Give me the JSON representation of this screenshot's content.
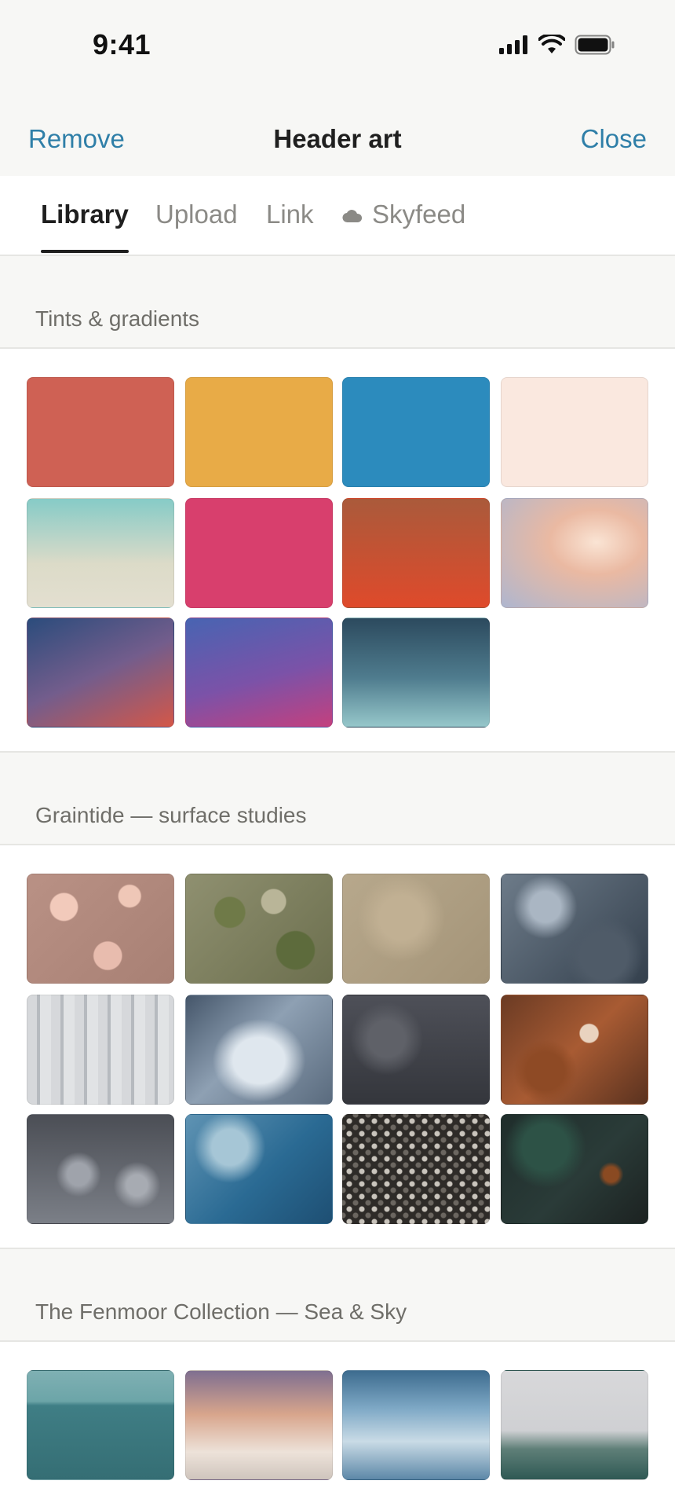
{
  "status": {
    "time": "9:41"
  },
  "nav": {
    "left": "Remove",
    "title": "Header art",
    "right": "Close"
  },
  "tabs": [
    {
      "label": "Library",
      "active": true
    },
    {
      "label": "Upload",
      "active": false
    },
    {
      "label": "Link",
      "active": false
    },
    {
      "label": "Skyfeed",
      "active": false,
      "icon": "cloud-icon"
    }
  ],
  "sections": [
    {
      "title": "Tints & gradients",
      "items": [
        {
          "name": "solid-red",
          "css": "#cf6154"
        },
        {
          "name": "solid-yellow",
          "css": "#e8ab47"
        },
        {
          "name": "solid-blue",
          "css": "#2c8bbd"
        },
        {
          "name": "solid-cream",
          "css": "#fae8df"
        },
        {
          "name": "gradient-teal-sand",
          "css": "linear-gradient(180deg,#86cbc7 0%,#dcdbc8 60%,#e3dfd0 100%)"
        },
        {
          "name": "solid-pink",
          "css": "#d83f6d"
        },
        {
          "name": "gradient-rust-orange",
          "css": "linear-gradient(180deg,#aa5a3b 0%,#df4a2b 100%)"
        },
        {
          "name": "gradient-peach-glow",
          "css": "radial-gradient(ellipse at 65% 40%,#fae4d4 0%,#eab9a2 35%,#aeb6cf 100%)"
        },
        {
          "name": "gradient-navy-coral",
          "css": "linear-gradient(155deg,#2b4c7c 0%,#735d8c 50%,#d45748 100%)"
        },
        {
          "name": "gradient-indigo-magenta",
          "css": "linear-gradient(165deg,#4864b2 0%,#7b52a8 55%,#c4407e 100%)"
        },
        {
          "name": "gradient-slate-seafoam",
          "css": "linear-gradient(180deg,#2c4a5e 0%,#4f7c8e 55%,#96c7ca 100%)"
        }
      ]
    },
    {
      "title": "Graintide — surface studies",
      "items": [
        {
          "name": "texture-rose-plaster",
          "css": "radial-gradient(circle at 25% 30%,#f2cabb 0 10%,transparent 11%),radial-gradient(circle at 70% 20%,#efc7b7 0 8%,transparent 9%),radial-gradient(circle at 55% 75%,#e8bcae 0 12%,transparent 13%),linear-gradient(135deg,#b99185,#a88074)"
        },
        {
          "name": "texture-moss-peel",
          "css": "radial-gradient(circle at 30% 35%,#6f7a48 0 12%,transparent 13%),radial-gradient(circle at 75% 70%,#5d6b3c 0 14%,transparent 15%),radial-gradient(circle at 60% 25%,#b9b598 0 10%,transparent 11%),linear-gradient(135deg,#8f9070,#6c6f4e)"
        },
        {
          "name": "texture-sand-stone",
          "css": "radial-gradient(circle at 40% 40%,#c1b093 0 20%,transparent 40%),linear-gradient(135deg,#b7a88c,#a49478)"
        },
        {
          "name": "texture-blue-grunge",
          "css": "radial-gradient(circle at 30% 30%,#aab6c3 0 12%,transparent 25%),radial-gradient(circle at 70% 75%,#4f5b68 0 18%,transparent 30%),linear-gradient(135deg,#6d7b89,#34404d)"
        },
        {
          "name": "texture-white-drip",
          "css": "repeating-linear-gradient(90deg,#d6d8db 0 12px,#b6babf 12px 16px,#e1e3e5 16px 30px),linear-gradient(180deg,#d0d2d5,#c2c5c9)"
        },
        {
          "name": "texture-frost-glass",
          "css": "radial-gradient(ellipse at 50% 60%,#dfe7ee 0 25%,transparent 45%),linear-gradient(135deg,#45566a,#8ea0b3 45%,#5a6b7e)"
        },
        {
          "name": "texture-charcoal-wall",
          "css": "radial-gradient(circle at 30% 40%,#5f6168 0 15%,transparent 30%),linear-gradient(180deg,#4e5058,#34363c)"
        },
        {
          "name": "texture-rust-patina",
          "css": "radial-gradient(circle at 60% 35%,#e9d3bf 0 8%,transparent 9%),radial-gradient(circle at 30% 70%,#8e4a25 0 15%,transparent 25%),linear-gradient(135deg,#6b3b24,#a85b33 50%,#5a321f)"
        },
        {
          "name": "texture-pewter-swirl",
          "css": "radial-gradient(circle at 35% 55%,#9fa3ab 0 10%,transparent 20%),radial-gradient(circle at 75% 65%,#a7abb2 0 8%,transparent 18%),linear-gradient(180deg,#4b4e55,#7b7f87)"
        },
        {
          "name": "texture-blue-droplets",
          "css": "radial-gradient(circle at 30% 30%,#a6c6d6 0 14%,transparent 28%),linear-gradient(135deg,#5f93b3,#2a6a93 55%,#1e4f73)"
        },
        {
          "name": "texture-pebble-gravel",
          "css": "radial-gradient(circle,#c9c4bc 0 3px,transparent 4px) 0 0/16px 16px,radial-gradient(circle,#6b6660 0 3px,transparent 4px) 8px 8px/16px 16px,#2e2b28"
        },
        {
          "name": "texture-verdigris-rust",
          "css": "radial-gradient(circle at 30% 30%,#2d5246 0 18%,transparent 32%),radial-gradient(circle at 75% 55%,#8a4a22 0 6%,transparent 10%),linear-gradient(135deg,#1f2d2b,#2a3b38 55%,#1c2221)"
        }
      ]
    },
    {
      "title": "The Fenmoor Collection — Sea & Sky",
      "items": [
        {
          "name": "photo-teal-sea",
          "css": "linear-gradient(180deg,#7fb0b3 0%,#6ca5a8 28%,#3f7e85 32%,#356e74 100%)"
        },
        {
          "name": "photo-dusk-shore",
          "css": "linear-gradient(180deg,#7f6f90 0%,#d8a58c 40%,#ede2d9 75%,#cfc5bd 100%)"
        },
        {
          "name": "photo-cloudy-sky",
          "css": "linear-gradient(180deg,#3d6c8f 0%,#7fa9c6 35%,#c9dbe6 65%,#5d88a8 100%)"
        },
        {
          "name": "photo-stormy-waves",
          "css": "linear-gradient(180deg,#d8d8da 0%,#cfd0d3 55%,#5f7f78 72%,#2f5954 100%)"
        }
      ]
    }
  ]
}
